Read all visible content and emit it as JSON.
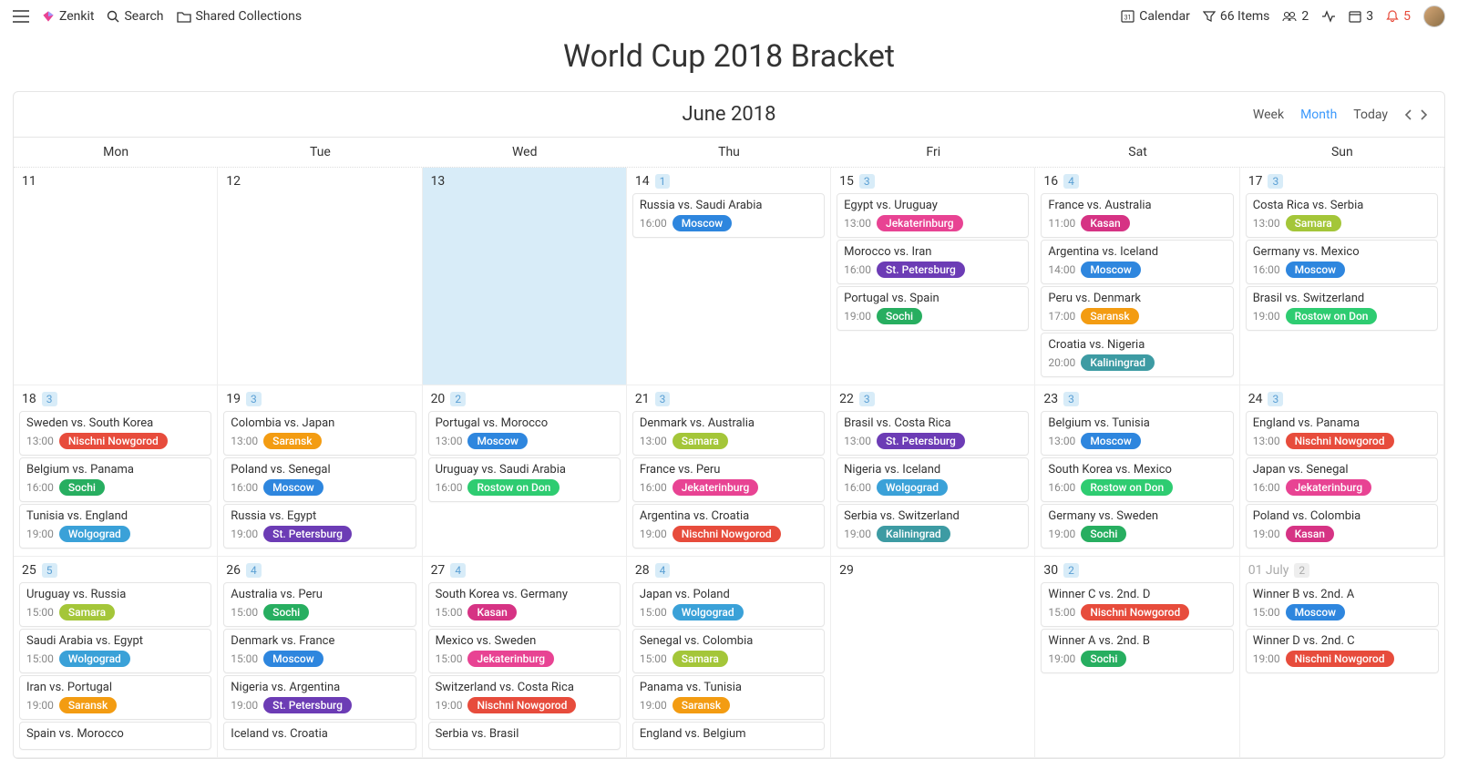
{
  "topbar": {
    "app": "Zenkit",
    "search": "Search",
    "shared": "Shared Collections",
    "calendar": "Calendar",
    "filter": "66 Items",
    "groupCount": "2",
    "calCount": "3",
    "bellCount": "5"
  },
  "page": {
    "title": "World Cup 2018 Bracket"
  },
  "calendar": {
    "month": "June 2018",
    "views": {
      "week": "Week",
      "month": "Month",
      "today": "Today"
    },
    "weekdays": [
      "Mon",
      "Tue",
      "Wed",
      "Thu",
      "Fri",
      "Sat",
      "Sun"
    ]
  },
  "cityColors": {
    "Moscow": "#2e86de",
    "Jekaterinburg": "#e84393",
    "St. Petersburg": "#6c3cb5",
    "Sochi": "#27ae60",
    "Kasan": "#d63384",
    "Samara": "#a4c639",
    "Saransk": "#f39c12",
    "Kaliningrad": "#3d9ba3",
    "Rostow on Don": "#2ecc71",
    "Nischni Nowgorod": "#e74c3c",
    "Wolgograd": "#3aa1d8"
  },
  "weeks": [
    [
      {
        "d": "11"
      },
      {
        "d": "12"
      },
      {
        "d": "13",
        "today": true
      },
      {
        "d": "14",
        "count": "1",
        "events": [
          {
            "t": "Russia vs. Saudi Arabia",
            "time": "16:00",
            "city": "Moscow"
          }
        ]
      },
      {
        "d": "15",
        "count": "3",
        "events": [
          {
            "t": "Egypt vs. Uruguay",
            "time": "13:00",
            "city": "Jekaterinburg"
          },
          {
            "t": "Morocco vs. Iran",
            "time": "16:00",
            "city": "St. Petersburg"
          },
          {
            "t": "Portugal vs. Spain",
            "time": "19:00",
            "city": "Sochi"
          }
        ]
      },
      {
        "d": "16",
        "count": "4",
        "events": [
          {
            "t": "France vs. Australia",
            "time": "11:00",
            "city": "Kasan"
          },
          {
            "t": "Argentina vs. Iceland",
            "time": "14:00",
            "city": "Moscow"
          },
          {
            "t": "Peru vs. Denmark",
            "time": "17:00",
            "city": "Saransk"
          },
          {
            "t": "Croatia vs. Nigeria",
            "time": "20:00",
            "city": "Kaliningrad"
          }
        ]
      },
      {
        "d": "17",
        "count": "3",
        "events": [
          {
            "t": "Costa Rica vs. Serbia",
            "time": "13:00",
            "city": "Samara"
          },
          {
            "t": "Germany vs. Mexico",
            "time": "16:00",
            "city": "Moscow"
          },
          {
            "t": "Brasil vs. Switzerland",
            "time": "19:00",
            "city": "Rostow on Don"
          }
        ]
      }
    ],
    [
      {
        "d": "18",
        "count": "3",
        "events": [
          {
            "t": "Sweden vs. South Korea",
            "time": "13:00",
            "city": "Nischni Nowgorod"
          },
          {
            "t": "Belgium vs. Panama",
            "time": "16:00",
            "city": "Sochi"
          },
          {
            "t": "Tunisia vs. England",
            "time": "19:00",
            "city": "Wolgograd"
          }
        ]
      },
      {
        "d": "19",
        "count": "3",
        "events": [
          {
            "t": "Colombia vs. Japan",
            "time": "13:00",
            "city": "Saransk"
          },
          {
            "t": "Poland vs. Senegal",
            "time": "16:00",
            "city": "Moscow"
          },
          {
            "t": "Russia vs. Egypt",
            "time": "19:00",
            "city": "St. Petersburg"
          }
        ]
      },
      {
        "d": "20",
        "count": "2",
        "events": [
          {
            "t": "Portugal vs. Morocco",
            "time": "13:00",
            "city": "Moscow"
          },
          {
            "t": "Uruguay vs. Saudi Arabia",
            "time": "16:00",
            "city": "Rostow on Don"
          }
        ]
      },
      {
        "d": "21",
        "count": "3",
        "events": [
          {
            "t": "Denmark vs. Australia",
            "time": "13:00",
            "city": "Samara"
          },
          {
            "t": "France vs. Peru",
            "time": "16:00",
            "city": "Jekaterinburg"
          },
          {
            "t": "Argentina vs. Croatia",
            "time": "19:00",
            "city": "Nischni Nowgorod"
          }
        ]
      },
      {
        "d": "22",
        "count": "3",
        "events": [
          {
            "t": "Brasil vs. Costa Rica",
            "time": "13:00",
            "city": "St. Petersburg"
          },
          {
            "t": "Nigeria vs. Iceland",
            "time": "16:00",
            "city": "Wolgograd"
          },
          {
            "t": "Serbia vs. Switzerland",
            "time": "19:00",
            "city": "Kaliningrad"
          }
        ]
      },
      {
        "d": "23",
        "count": "3",
        "events": [
          {
            "t": "Belgium vs. Tunisia",
            "time": "13:00",
            "city": "Moscow"
          },
          {
            "t": "South Korea vs. Mexico",
            "time": "16:00",
            "city": "Rostow on Don"
          },
          {
            "t": "Germany vs. Sweden",
            "time": "19:00",
            "city": "Sochi"
          }
        ]
      },
      {
        "d": "24",
        "count": "3",
        "events": [
          {
            "t": "England vs. Panama",
            "time": "13:00",
            "city": "Nischni Nowgorod"
          },
          {
            "t": "Japan vs. Senegal",
            "time": "16:00",
            "city": "Jekaterinburg"
          },
          {
            "t": "Poland vs. Colombia",
            "time": "19:00",
            "city": "Kasan"
          }
        ]
      }
    ],
    [
      {
        "d": "25",
        "count": "5",
        "events": [
          {
            "t": "Uruguay vs. Russia",
            "time": "15:00",
            "city": "Samara"
          },
          {
            "t": "Saudi Arabia vs. Egypt",
            "time": "15:00",
            "city": "Wolgograd"
          },
          {
            "t": "Iran vs. Portugal",
            "time": "19:00",
            "city": "Saransk"
          },
          {
            "t": "Spain vs. Morocco"
          }
        ]
      },
      {
        "d": "26",
        "count": "4",
        "events": [
          {
            "t": "Australia vs. Peru",
            "time": "15:00",
            "city": "Sochi"
          },
          {
            "t": "Denmark vs. France",
            "time": "15:00",
            "city": "Moscow"
          },
          {
            "t": "Nigeria vs. Argentina",
            "time": "19:00",
            "city": "St. Petersburg"
          },
          {
            "t": "Iceland vs. Croatia"
          }
        ]
      },
      {
        "d": "27",
        "count": "4",
        "events": [
          {
            "t": "South Korea vs. Germany",
            "time": "15:00",
            "city": "Kasan"
          },
          {
            "t": "Mexico vs. Sweden",
            "time": "15:00",
            "city": "Jekaterinburg"
          },
          {
            "t": "Switzerland vs. Costa Rica",
            "time": "19:00",
            "city": "Nischni Nowgorod"
          },
          {
            "t": "Serbia vs. Brasil"
          }
        ]
      },
      {
        "d": "28",
        "count": "4",
        "events": [
          {
            "t": "Japan vs. Poland",
            "time": "15:00",
            "city": "Wolgograd"
          },
          {
            "t": "Senegal vs. Colombia",
            "time": "15:00",
            "city": "Samara"
          },
          {
            "t": "Panama vs. Tunisia",
            "time": "19:00",
            "city": "Saransk"
          },
          {
            "t": "England vs. Belgium"
          }
        ]
      },
      {
        "d": "29"
      },
      {
        "d": "30",
        "count": "2",
        "events": [
          {
            "t": "Winner C vs. 2nd. D",
            "time": "15:00",
            "city": "Nischni Nowgorod"
          },
          {
            "t": "Winner A vs. 2nd. B",
            "time": "19:00",
            "city": "Sochi"
          }
        ]
      },
      {
        "d": "01 July",
        "count": "2",
        "outside": true,
        "events": [
          {
            "t": "Winner B vs. 2nd. A",
            "time": "15:00",
            "city": "Moscow"
          },
          {
            "t": "Winner D vs. 2nd. C",
            "time": "19:00",
            "city": "Nischni Nowgorod"
          }
        ]
      }
    ]
  ]
}
